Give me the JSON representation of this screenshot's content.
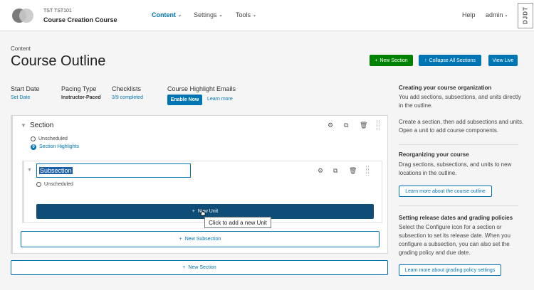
{
  "header": {
    "course_number": "TST TST101",
    "course_name": "Course Creation Course",
    "nav": [
      "Content",
      "Settings",
      "Tools"
    ],
    "help": "Help",
    "user": "admin",
    "debug_toolbar": "DJDT"
  },
  "page": {
    "small_title": "Content",
    "title": "Course Outline",
    "buttons": {
      "new_section": "New Section",
      "collapse_all": "Collapse All Sections",
      "view_live": "View Live"
    }
  },
  "stats": {
    "start_date_label": "Start Date",
    "start_date_value": "Set Date",
    "pacing_label": "Pacing Type",
    "pacing_value": "Instructor-Paced",
    "checklists_label": "Checklists",
    "checklists_value": "3/9 completed",
    "emails_label": "Course Highlight Emails",
    "enable_now": "Enable Now",
    "learn_more": "Learn more"
  },
  "outline": {
    "section_title": "Section",
    "section_status": "Unscheduled",
    "highlights_count": "0",
    "highlights_link": "Section Highlights",
    "subsection_value": "Subsection",
    "subsection_status": "Unscheduled",
    "new_unit": "New Unit",
    "tooltip": "Click to add a new Unit",
    "new_subsection": "New Subsection",
    "new_section": "New Section"
  },
  "sidebar": {
    "h1": "Creating your course organization",
    "p1a": "You add sections, subsections, and units directly in the outline.",
    "p1b": "Create a section, then add subsections and units. Open a unit to add course components.",
    "h2": "Reorganizing your course",
    "p2": "Drag sections, subsections, and units to new locations in the outline.",
    "btn2": "Learn more about the course outline",
    "h3": "Setting release dates and grading policies",
    "p3": "Select the Configure icon for a section or subsection to set its release date. When you configure a subsection, you can also set the grading policy and due date.",
    "btn3": "Learn more about grading policy settings"
  },
  "colors": {
    "primary": "#0075b4",
    "success": "#008100",
    "unit_button": "#0f4d78"
  }
}
